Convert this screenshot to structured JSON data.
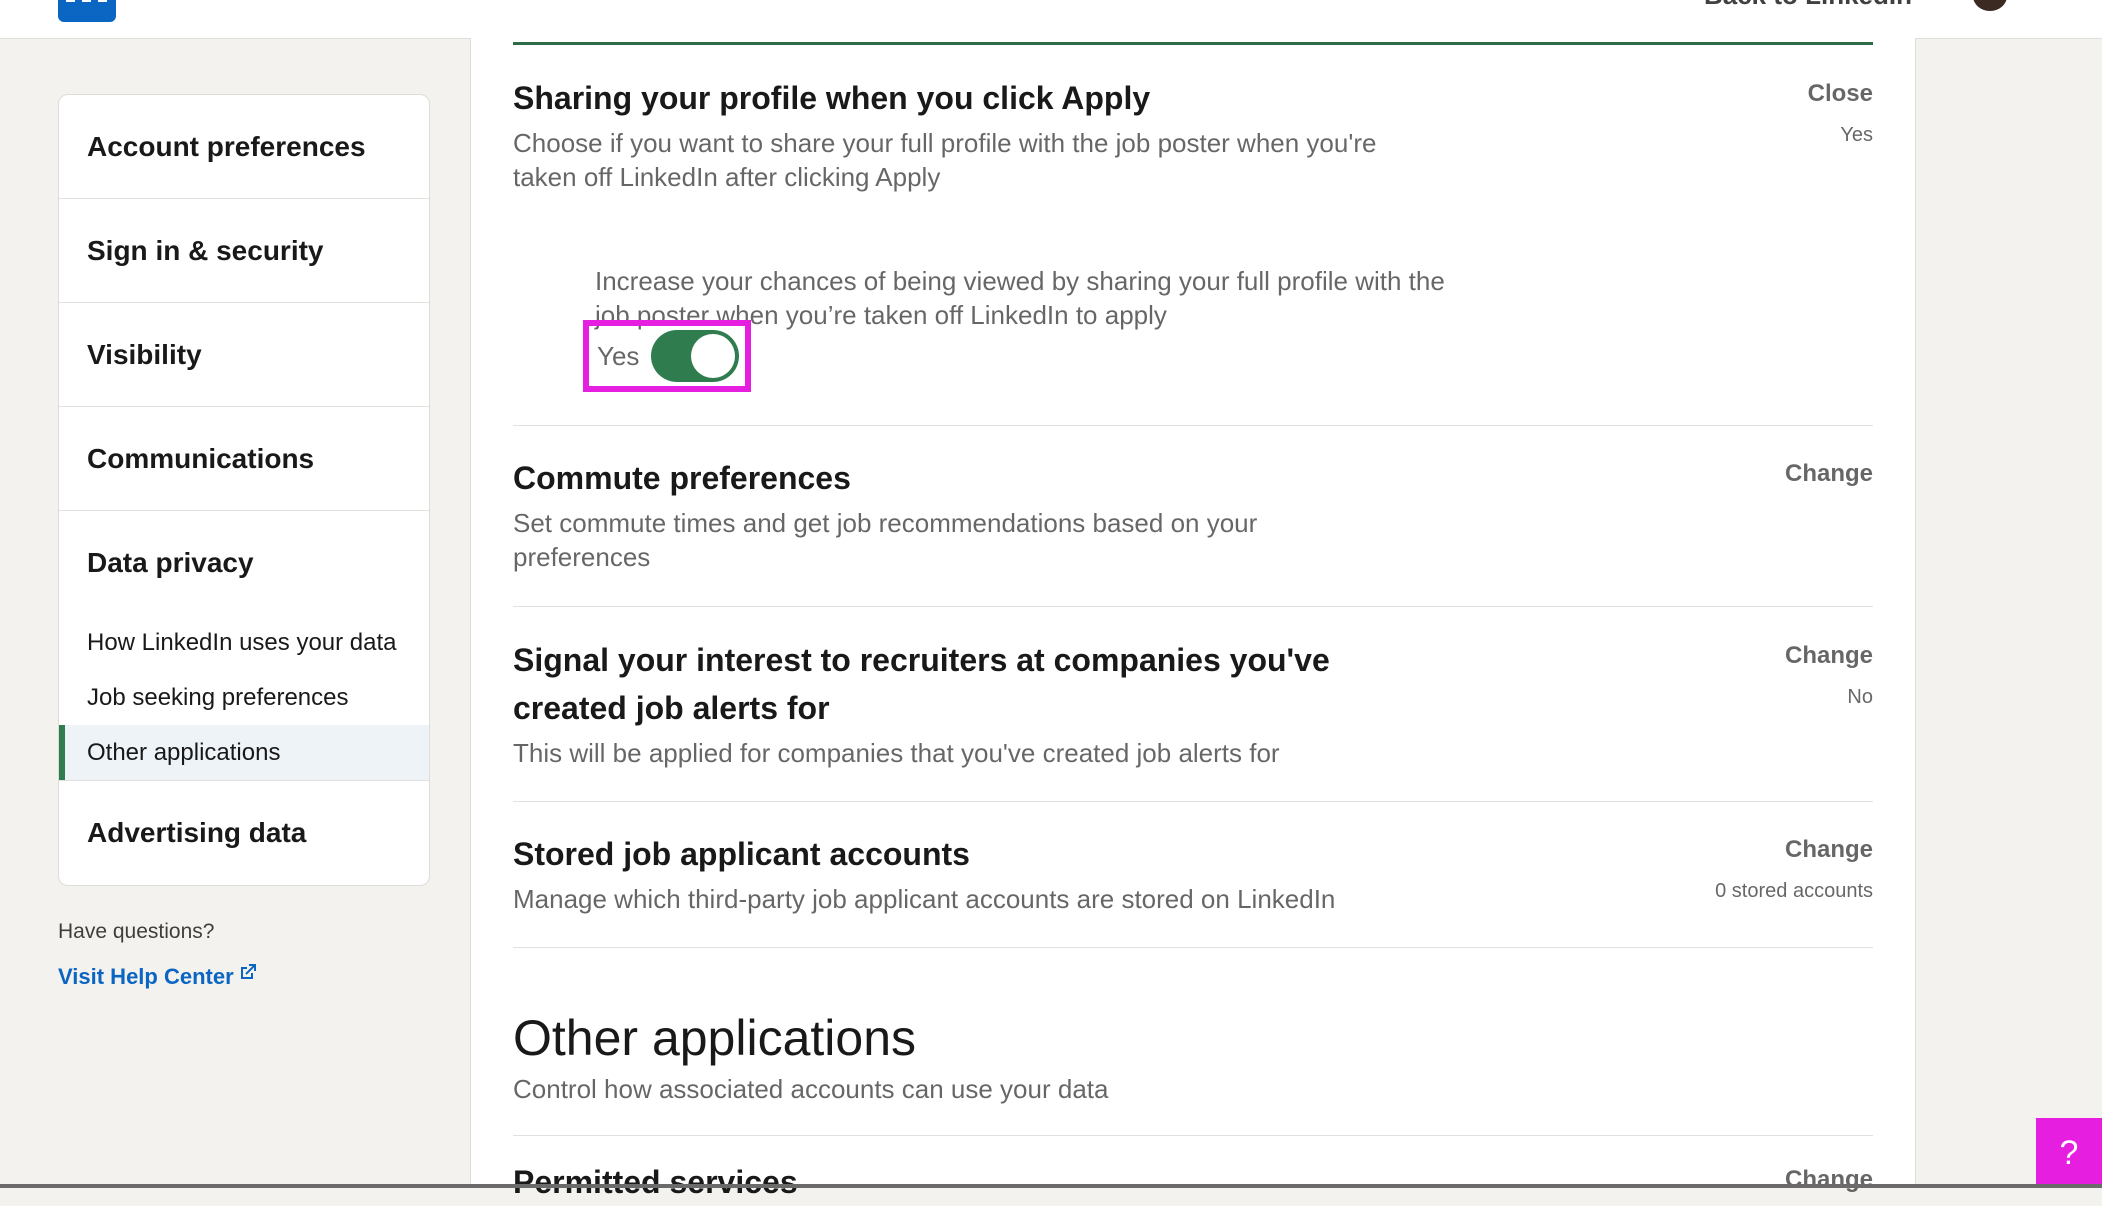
{
  "header": {
    "logo_text": "in",
    "back_link": "Back to LinkedIn"
  },
  "sidebar": {
    "items": [
      {
        "label": "Account preferences"
      },
      {
        "label": "Sign in & security"
      },
      {
        "label": "Visibility"
      },
      {
        "label": "Communications"
      }
    ],
    "data_privacy": {
      "title": "Data privacy",
      "subitems": [
        {
          "label": "How LinkedIn uses your data"
        },
        {
          "label": "Job seeking preferences"
        },
        {
          "label": "Other applications",
          "active": true
        }
      ]
    },
    "advertising": {
      "label": "Advertising data"
    },
    "questions": "Have questions?",
    "help_link": "Visit Help Center"
  },
  "main": {
    "sharing": {
      "title": "Sharing your profile when you click Apply",
      "desc_line1": "Choose if you want to share your full profile with the job poster when you're",
      "desc_line2": "taken off LinkedIn after clicking Apply",
      "action": "Close",
      "status": "Yes",
      "detail_line1": "Increase your chances of being viewed by sharing your full profile with the",
      "detail_line2": "job poster when you’re taken off LinkedIn to apply",
      "toggle_label": "Yes",
      "toggle_on": true
    },
    "commute": {
      "title": "Commute preferences",
      "desc_line1": "Set commute times and get job recommendations based on your",
      "desc_line2": "preferences",
      "action": "Change"
    },
    "signal": {
      "title_line1": "Signal your interest to recruiters at companies you've",
      "title_line2": "created job alerts for",
      "desc": "This will be applied for companies that you've created job alerts for",
      "action": "Change",
      "status": "No"
    },
    "stored": {
      "title": "Stored job applicant accounts",
      "desc": "Manage which third-party job applicant accounts are stored on LinkedIn",
      "action": "Change",
      "status": "0 stored accounts"
    },
    "other_apps": {
      "heading": "Other applications",
      "desc": "Control how associated accounts can use your data"
    },
    "permitted": {
      "title": "Permitted services",
      "action": "Change"
    }
  },
  "fab": {
    "label": "?"
  },
  "colors": {
    "accent_green": "#2f7d4e",
    "highlight_magenta": "#e61ee0",
    "link_blue": "#0a66c2"
  }
}
